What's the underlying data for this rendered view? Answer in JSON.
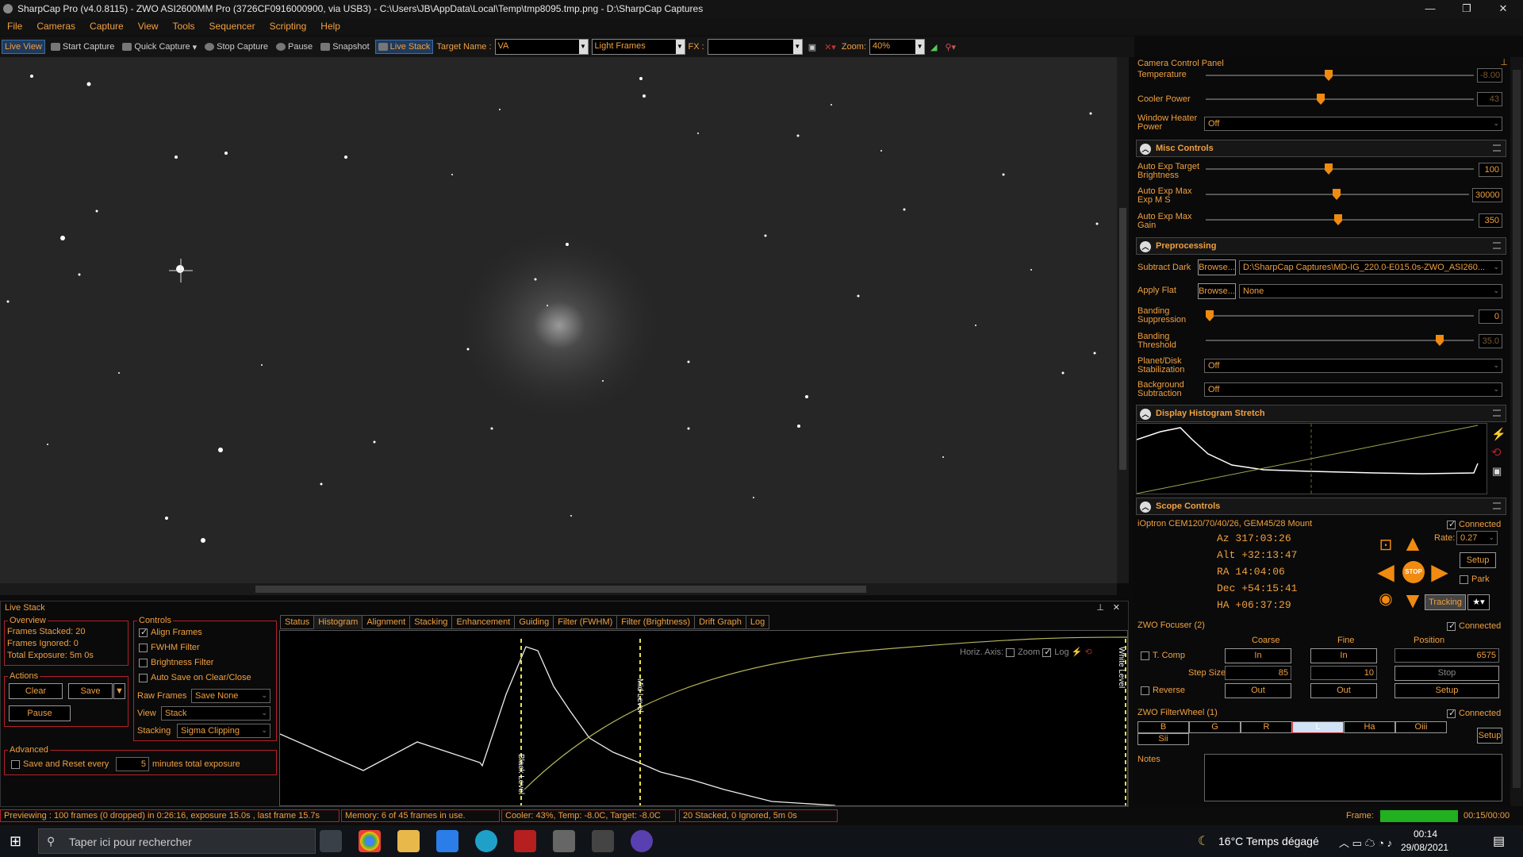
{
  "titlebar": {
    "title": "SharpCap Pro (v4.0.8115) - ZWO ASI2600MM Pro (3726CF0916000900, via USB3) - C:\\Users\\JB\\AppData\\Local\\Temp\\tmp8095.tmp.png - D:\\SharpCap Captures"
  },
  "menu": [
    "File",
    "Cameras",
    "Capture",
    "View",
    "Tools",
    "Sequencer",
    "Scripting",
    "Help"
  ],
  "toolbar": {
    "live_view": "Live View",
    "start_capture": "Start Capture",
    "quick_capture": "Quick Capture",
    "stop_capture": "Stop Capture",
    "pause": "Pause",
    "snapshot": "Snapshot",
    "live_stack": "Live Stack",
    "target_label": "Target Name :",
    "target_value": "VA",
    "frame_type": "Light Frames",
    "fx_label": "FX :",
    "fx_value": "",
    "zoom_label": "Zoom:",
    "zoom_value": "40%"
  },
  "livestack": {
    "title": "Live Stack",
    "overview": {
      "title": "Overview",
      "frames_stacked": "Frames Stacked: 20",
      "frames_ignored": "Frames Ignored:  0",
      "total_exposure": "Total Exposure:   5m 0s"
    },
    "actions": {
      "title": "Actions",
      "clear": "Clear",
      "save": "Save",
      "pause": "Pause"
    },
    "advanced": {
      "title": "Advanced",
      "save_reset": "Save and Reset every",
      "minutes_value": "5",
      "minutes_label": "minutes total exposure"
    },
    "controls": {
      "title": "Controls",
      "align": "Align Frames",
      "fwhm": "FWHM Filter",
      "brightness": "Brightness Filter",
      "autosave": "Auto Save on Clear/Close",
      "raw_label": "Raw Frames",
      "raw_value": "Save None",
      "view_label": "View",
      "view_value": "Stack",
      "stacking_label": "Stacking",
      "stacking_value": "Sigma Clipping"
    },
    "tabs": [
      "Status",
      "Histogram",
      "Alignment",
      "Stacking",
      "Enhancement",
      "Guiding",
      "Filter (FWHM)",
      "Filter (Brightness)",
      "Drift Graph",
      "Log"
    ],
    "hist": {
      "horiz_axis": "Horiz. Axis:",
      "zoom": "Zoom",
      "log": "Log",
      "black_level": "Black Level",
      "mid_level": "Mid Level",
      "white_level": "White Level"
    }
  },
  "status": {
    "preview": "Previewing : 100 frames (0 dropped) in 0:26:16, exposure 15.0s , last frame 15.7s",
    "memory": "Memory: 6 of 45 frames in use.",
    "cooler": "Cooler: 43%, Temp: -8.0C, Target: -8.0C",
    "stacked": "20 Stacked, 0 Ignored, 5m 0s",
    "frame_label": "Frame:",
    "frame_time": "00:15/00:00"
  },
  "panel": {
    "title": "Camera Control Panel",
    "temperature": {
      "label": "Temperature",
      "value": "-8.00"
    },
    "cooler": {
      "label": "Cooler Power",
      "value": "43"
    },
    "heater": {
      "label": "Window Heater Power",
      "value": "Off"
    },
    "misc": {
      "title": "Misc Controls",
      "target_bright": {
        "label": "Auto Exp Target Brightness",
        "value": "100"
      },
      "max_ms": {
        "label": "Auto Exp Max Exp M S",
        "value": "30000"
      },
      "max_gain": {
        "label": "Auto Exp Max Gain",
        "value": "350"
      }
    },
    "pre": {
      "title": "Preprocessing",
      "dark_label": "Subtract Dark",
      "browse": "Browse...",
      "dark_value": "D:\\SharpCap Captures\\MD-IG_220.0-E015.0s-ZWO_ASI260...",
      "flat_label": "Apply Flat",
      "flat_value": "None",
      "band_sup": {
        "label": "Banding Suppression",
        "value": "0"
      },
      "band_thr": {
        "label": "Banding Threshold",
        "value": "35.0"
      },
      "planet": {
        "label": "Planet/Disk Stabilization",
        "value": "Off"
      },
      "bg": {
        "label": "Background Subtraction",
        "value": "Off"
      }
    },
    "hist": {
      "title": "Display Histogram Stretch"
    },
    "scope": {
      "title": "Scope Controls",
      "mount": "iOptron CEM120/70/40/26, GEM45/28 Mount",
      "connected": "Connected",
      "az": "Az   317:03:26",
      "alt": "Alt  +32:13:47",
      "ra": "RA    14:04:06",
      "dec": "Dec  +54:15:41",
      "ha": "HA   +06:37:29",
      "rate_label": "Rate:",
      "rate_value": "0.27",
      "setup": "Setup",
      "park": "Park",
      "stop": "STOP",
      "tracking": "Tracking"
    },
    "focuser": {
      "title": "ZWO Focuser (2)",
      "connected": "Connected",
      "coarse": "Coarse",
      "fine": "Fine",
      "position": "Position",
      "tcomp": "T. Comp",
      "in": "In",
      "pos_value": "6575",
      "step_label": "Step Size",
      "coarse_step": "85",
      "fine_step": "10",
      "stop": "Stop",
      "reverse": "Reverse",
      "out": "Out",
      "setup": "Setup"
    },
    "wheel": {
      "title": "ZWO FilterWheel (1)",
      "connected": "Connected",
      "filters": [
        "B",
        "G",
        "R",
        "L",
        "Ha",
        "Oiii",
        "Sii"
      ],
      "selected": "L",
      "setup": "Setup"
    },
    "notes": {
      "label": "Notes"
    }
  },
  "taskbar": {
    "search": "Taper ici pour rechercher",
    "weather": "16°C  Temps dégagé",
    "time": "00:14",
    "date": "29/08/2021"
  }
}
